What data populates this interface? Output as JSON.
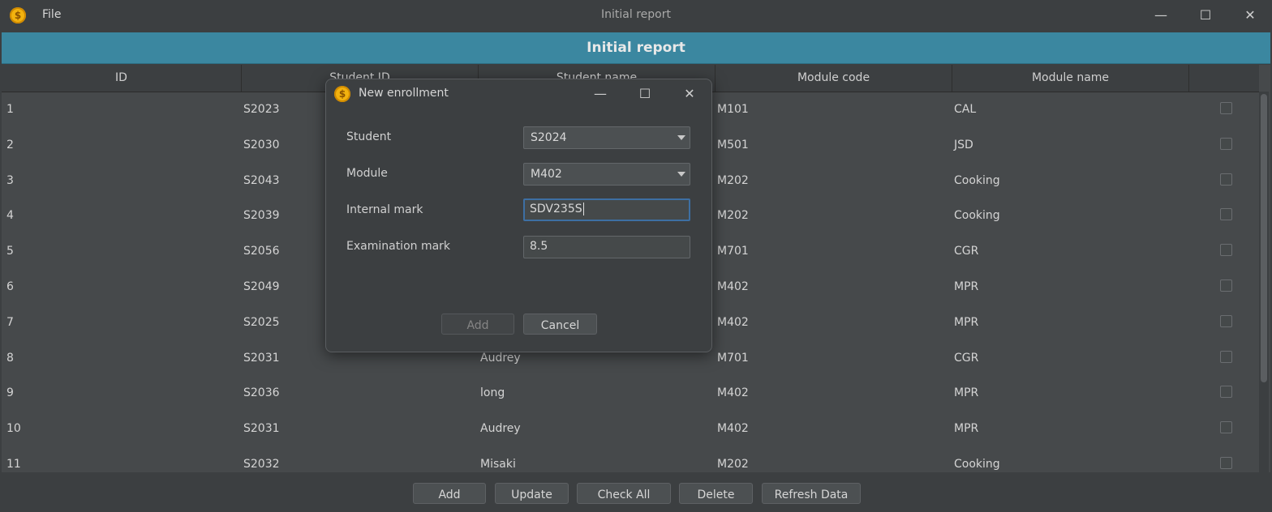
{
  "app": {
    "icon": "coin-icon",
    "menu_file": "File",
    "window_title": "Initial report",
    "controls": {
      "minimize": "—",
      "maximize": "☐",
      "close": "✕"
    }
  },
  "header": {
    "title": "Initial report"
  },
  "table": {
    "columns": [
      "ID",
      "Student ID",
      "Student name",
      "Module code",
      "Module name",
      ""
    ],
    "rows": [
      {
        "id": "1",
        "student_id": "S2023",
        "student_name": "",
        "module_code": "M101",
        "module_name": "CAL",
        "checked": false
      },
      {
        "id": "2",
        "student_id": "S2030",
        "student_name": "",
        "module_code": "M501",
        "module_name": "JSD",
        "checked": false
      },
      {
        "id": "3",
        "student_id": "S2043",
        "student_name": "",
        "module_code": "M202",
        "module_name": "Cooking",
        "checked": false
      },
      {
        "id": "4",
        "student_id": "S2039",
        "student_name": "",
        "module_code": "M202",
        "module_name": "Cooking",
        "checked": false
      },
      {
        "id": "5",
        "student_id": "S2056",
        "student_name": "",
        "module_code": "M701",
        "module_name": "CGR",
        "checked": false
      },
      {
        "id": "6",
        "student_id": "S2049",
        "student_name": "",
        "module_code": "M402",
        "module_name": "MPR",
        "checked": false
      },
      {
        "id": "7",
        "student_id": "S2025",
        "student_name": "",
        "module_code": "M402",
        "module_name": "MPR",
        "checked": false
      },
      {
        "id": "8",
        "student_id": "S2031",
        "student_name": "Audrey",
        "module_code": "M701",
        "module_name": "CGR",
        "checked": false
      },
      {
        "id": "9",
        "student_id": "S2036",
        "student_name": "long",
        "module_code": "M402",
        "module_name": "MPR",
        "checked": false
      },
      {
        "id": "10",
        "student_id": "S2031",
        "student_name": "Audrey",
        "module_code": "M402",
        "module_name": "MPR",
        "checked": false
      },
      {
        "id": "11",
        "student_id": "S2032",
        "student_name": "Misaki",
        "module_code": "M202",
        "module_name": "Cooking",
        "checked": false
      }
    ]
  },
  "buttons": {
    "add": "Add",
    "update": "Update",
    "check_all": "Check All",
    "delete": "Delete",
    "refresh": "Refresh Data"
  },
  "dialog": {
    "title": "New enrollment",
    "icon": "coin-icon",
    "student_label": "Student",
    "student_value": "S2024",
    "module_label": "Module",
    "module_value": "M402",
    "internal_label": "Internal mark",
    "internal_value": "SDV235S",
    "exam_label": "Examination mark",
    "exam_value": "8.5",
    "add_label": "Add",
    "cancel_label": "Cancel"
  }
}
